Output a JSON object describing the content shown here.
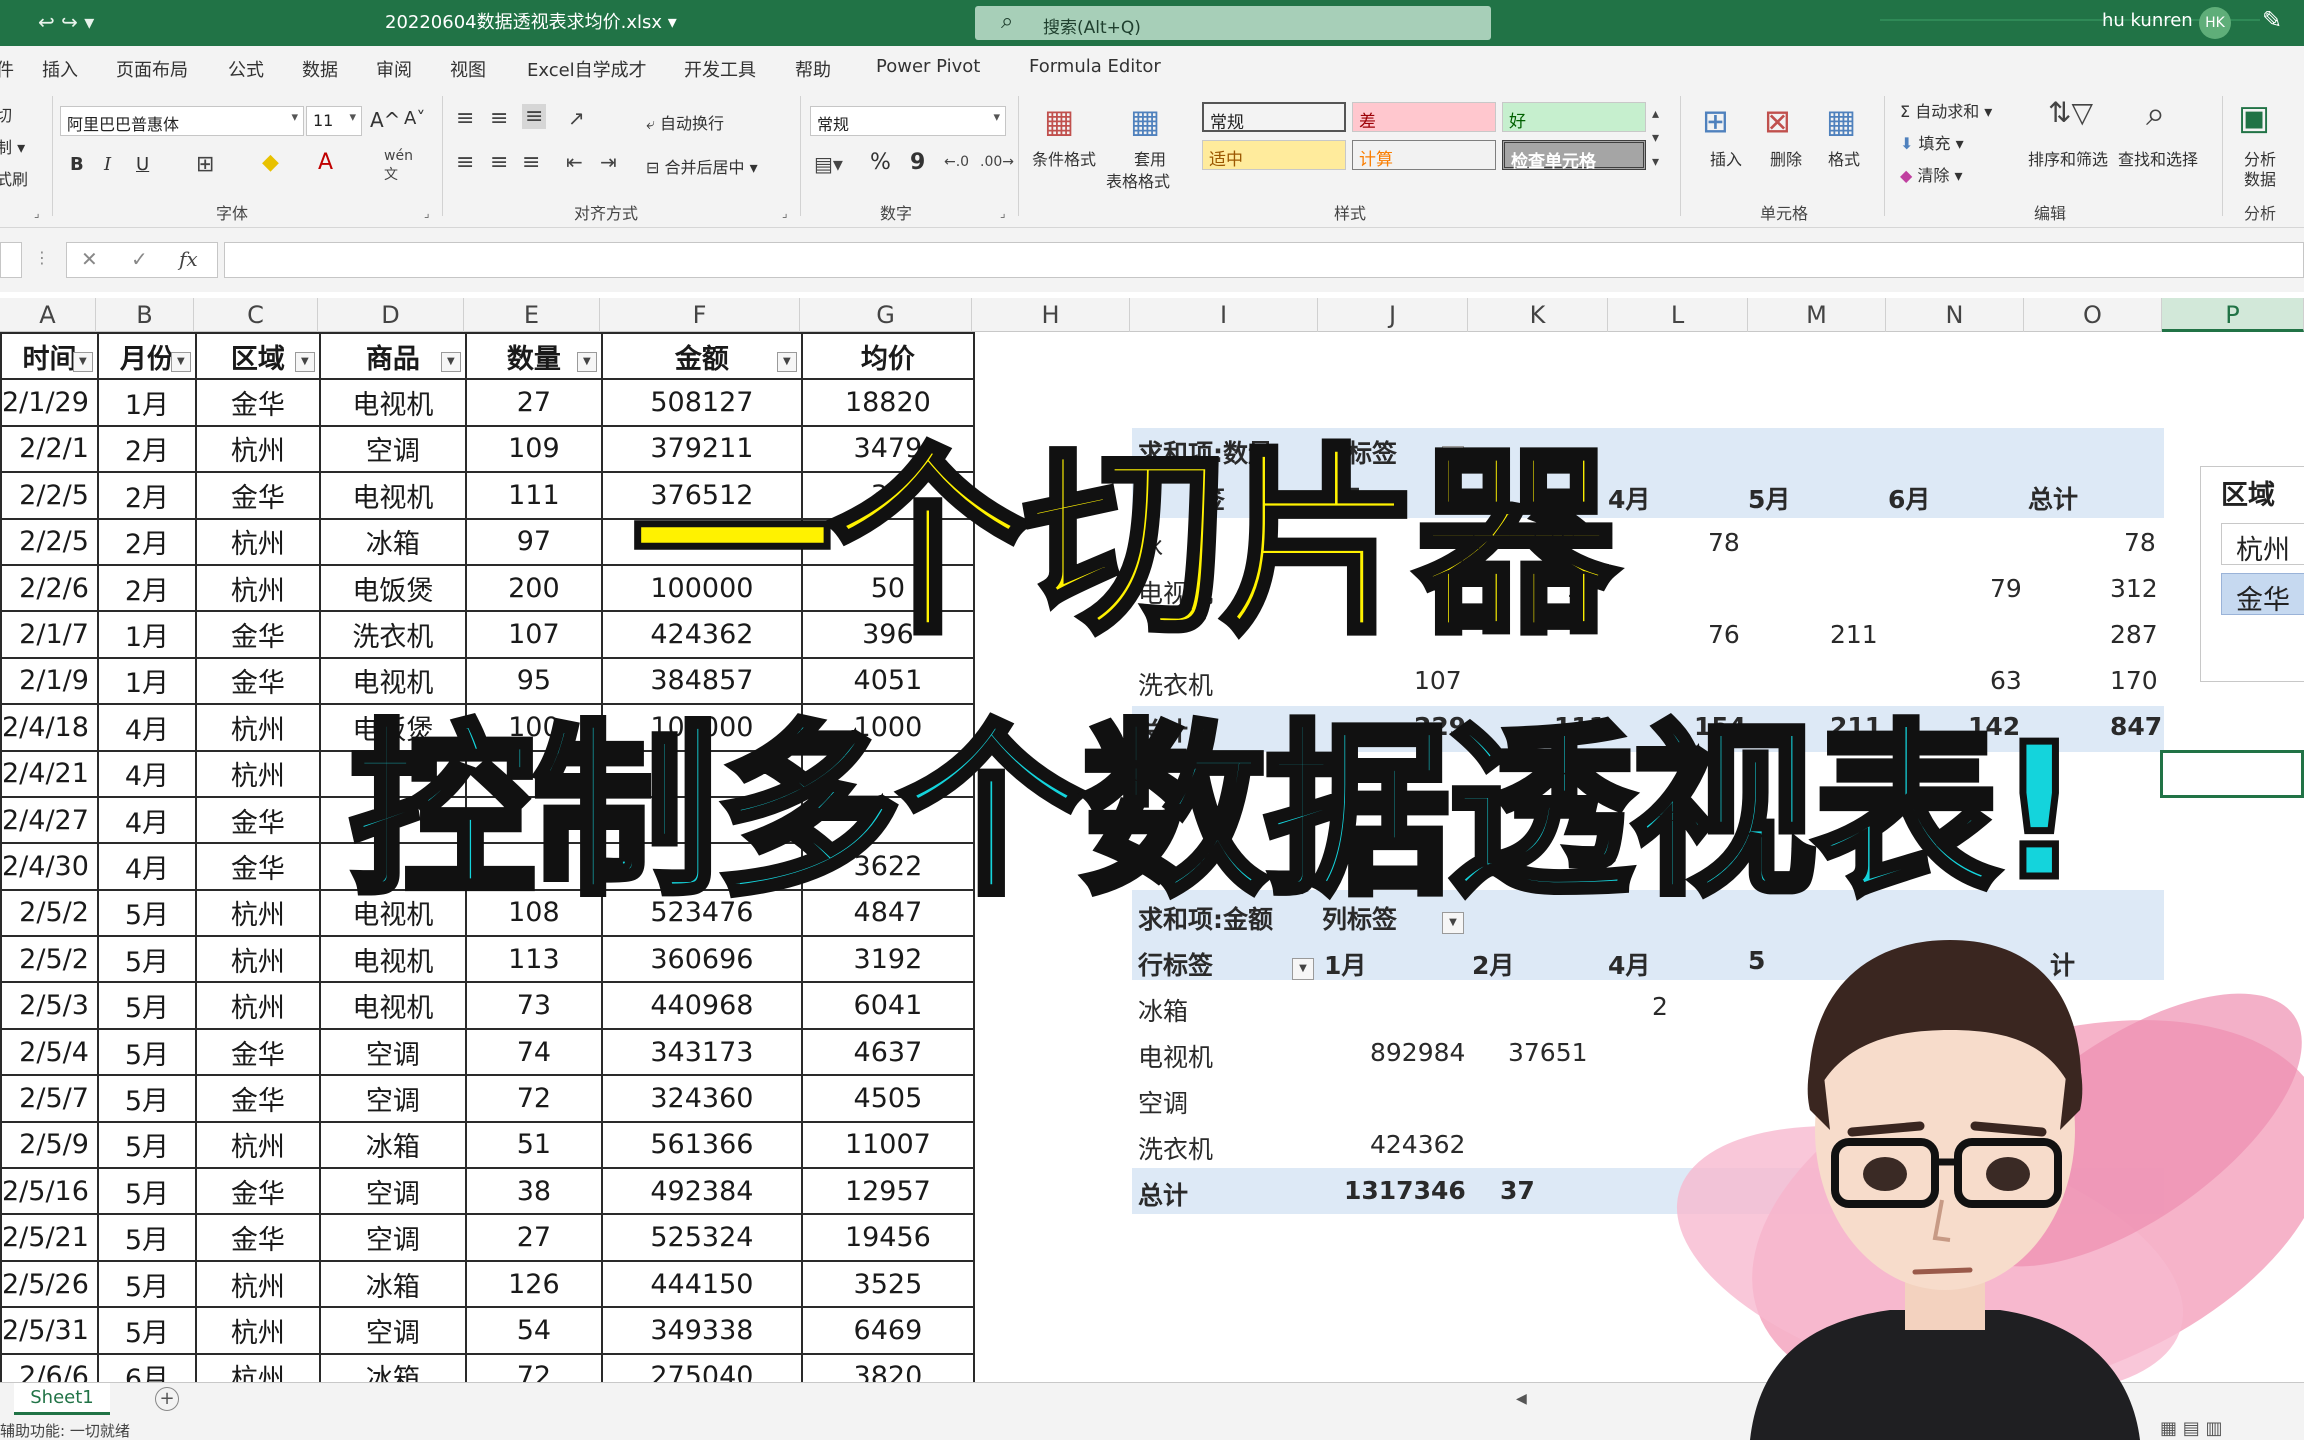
{
  "titlebar": {
    "qat": "↩ ↪ ▾",
    "doc_title": "20220604数据透视表求均价.xlsx ▾",
    "search_placeholder": "搜索(Alt+Q)",
    "user": "hu kunren",
    "avatar_initials": "HK"
  },
  "tabs": [
    "插入",
    "页面布局",
    "公式",
    "数据",
    "审阅",
    "视图",
    "Excel自学成才",
    "开发工具",
    "帮助",
    "Power Pivot",
    "Formula Editor"
  ],
  "tabs_first_partial": "件",
  "ribbon": {
    "clipboard_partial": [
      "切",
      "制 ▾",
      "式刷"
    ],
    "font_name": "阿里巴巴普惠体",
    "font_size": "11",
    "grow_font": "A^",
    "shrink_font": "A˅",
    "bold": "B",
    "italic": "I",
    "underline": "U",
    "font_group": "字体",
    "wrap_text": "自动换行",
    "merge_center": "合并后居中",
    "align_group": "对齐方式",
    "number_format": "常规",
    "percent": "%",
    "comma": "9",
    "number_group": "数字",
    "cond_format": "条件格式",
    "table_format_1": "套用",
    "table_format_2": "表格格式",
    "styles": [
      {
        "label": "常规",
        "bg": "#ffffff",
        "fg": "#222222"
      },
      {
        "label": "差",
        "bg": "#ffc7ce",
        "fg": "#9c0006"
      },
      {
        "label": "好",
        "bg": "#c6efce",
        "fg": "#006100"
      },
      {
        "label": "适中",
        "bg": "#ffeb9c",
        "fg": "#9c5700"
      },
      {
        "label": "计算",
        "bg": "#f2f2f2",
        "fg": "#fa7d00"
      },
      {
        "label": "检查单元格",
        "bg": "#a5a5a5",
        "fg": "#ffffff"
      }
    ],
    "styles_group": "样式",
    "insert": "插入",
    "delete": "删除",
    "format": "格式",
    "cells_group": "单元格",
    "autosum": "自动求和",
    "fill": "填充",
    "clear": "清除",
    "sort_filter": "排序和筛选",
    "find_select": "查找和选择",
    "edit_group": "编辑",
    "analyze_1": "分析",
    "analyze_2": "数据",
    "analysis_group": "分析"
  },
  "formula_bar": {
    "cancel": "✕",
    "enter": "✓",
    "fx": "fx",
    "value": ""
  },
  "columns": [
    "A",
    "B",
    "C",
    "D",
    "E",
    "F",
    "G",
    "H",
    "I",
    "J",
    "K",
    "L",
    "M",
    "N",
    "O",
    "P"
  ],
  "table": {
    "headers": [
      "时间",
      "月份",
      "区域",
      "商品",
      "数量",
      "金额",
      "均价"
    ],
    "rows": [
      [
        "2/1/29",
        "1月",
        "金华",
        "电视机",
        "27",
        "508127",
        "18820"
      ],
      [
        "2/2/1",
        "2月",
        "杭州",
        "空调",
        "109",
        "379211",
        "3479"
      ],
      [
        "2/2/5",
        "2月",
        "金华",
        "电视机",
        "111",
        "376512",
        "33"
      ],
      [
        "2/2/5",
        "2月",
        "杭州",
        "冰箱",
        "97",
        "",
        ""
      ],
      [
        "2/2/6",
        "2月",
        "杭州",
        "电饭煲",
        "200",
        "100000",
        "50"
      ],
      [
        "2/1/7",
        "1月",
        "金华",
        "洗衣机",
        "107",
        "424362",
        "396"
      ],
      [
        "2/1/9",
        "1月",
        "金华",
        "电视机",
        "95",
        "384857",
        "4051"
      ],
      [
        "2/4/18",
        "4月",
        "杭州",
        "电饭煲",
        "100",
        "100000",
        "1000"
      ],
      [
        "2/4/21",
        "4月",
        "杭州",
        "",
        "",
        "",
        ""
      ],
      [
        "2/4/27",
        "4月",
        "金华",
        "",
        "",
        "",
        ""
      ],
      [
        "2/4/30",
        "4月",
        "金华",
        "",
        "",
        "",
        "3622"
      ],
      [
        "2/5/2",
        "5月",
        "杭州",
        "电视机",
        "108",
        "523476",
        "4847"
      ],
      [
        "2/5/2",
        "5月",
        "杭州",
        "电视机",
        "113",
        "360696",
        "3192"
      ],
      [
        "2/5/3",
        "5月",
        "杭州",
        "电视机",
        "73",
        "440968",
        "6041"
      ],
      [
        "2/5/4",
        "5月",
        "金华",
        "空调",
        "74",
        "343173",
        "4637"
      ],
      [
        "2/5/7",
        "5月",
        "金华",
        "空调",
        "72",
        "324360",
        "4505"
      ],
      [
        "2/5/9",
        "5月",
        "杭州",
        "冰箱",
        "51",
        "561366",
        "11007"
      ],
      [
        "2/5/16",
        "5月",
        "金华",
        "空调",
        "38",
        "492384",
        "12957"
      ],
      [
        "2/5/21",
        "5月",
        "金华",
        "空调",
        "27",
        "525324",
        "19456"
      ],
      [
        "2/5/26",
        "5月",
        "杭州",
        "冰箱",
        "126",
        "444150",
        "3525"
      ],
      [
        "2/5/31",
        "5月",
        "杭州",
        "空调",
        "54",
        "349338",
        "6469"
      ],
      [
        "2/6/6",
        "6月",
        "杭州",
        "冰箱",
        "72",
        "275040",
        "3820"
      ]
    ]
  },
  "pivot1": {
    "value_field": "求和项:数量",
    "col_label": "列标签",
    "row_label_partial": "签",
    "month_partial": "月",
    "months": [
      "4月",
      "5月",
      "6月",
      "总计"
    ],
    "rows": [
      {
        "label": "冰",
        "cells": [
          "78",
          "",
          "",
          "78"
        ]
      },
      {
        "label": "电视机",
        "cells": [
          "1",
          "",
          "79",
          "312"
        ]
      },
      {
        "label": "",
        "cells": [
          "76",
          "211",
          "",
          "287"
        ]
      },
      {
        "label": "洗衣机",
        "cells": [
          "107",
          "",
          "63",
          "170"
        ]
      }
    ],
    "total_label": "总计",
    "totals": [
      "229",
      "111",
      "154",
      "211",
      "142",
      "847"
    ]
  },
  "pivot2": {
    "value_field": "求和项:金额",
    "col_label": "列标签",
    "row_label": "行标签",
    "months": [
      "1月",
      "2月",
      "4月",
      "5",
      "计"
    ],
    "rows": [
      {
        "label": "冰箱",
        "cells": [
          "",
          "",
          "2"
        ]
      },
      {
        "label": "电视机",
        "cells": [
          "892984",
          "37651",
          ""
        ]
      },
      {
        "label": "空调",
        "cells": [
          "",
          "",
          ""
        ]
      },
      {
        "label": "洗衣机",
        "cells": [
          "424362",
          "",
          ""
        ]
      }
    ],
    "total_label": "总计",
    "totals": [
      "1317346",
      "37"
    ]
  },
  "slicer": {
    "title": "区域",
    "items": [
      {
        "label": "杭州",
        "selected": false
      },
      {
        "label": "金华",
        "selected": true
      }
    ]
  },
  "sheets": [
    "Sheet1"
  ],
  "status": "辅助功能: 一切就绪",
  "overlay": {
    "line1": "一个切片器",
    "line2": "控制多个数据透视表!"
  },
  "colors": {
    "excel_green": "#217346",
    "pivot_band": "#dde9f6",
    "caption_yellow": "#fff200",
    "caption_cyan": "#14d4dc"
  }
}
